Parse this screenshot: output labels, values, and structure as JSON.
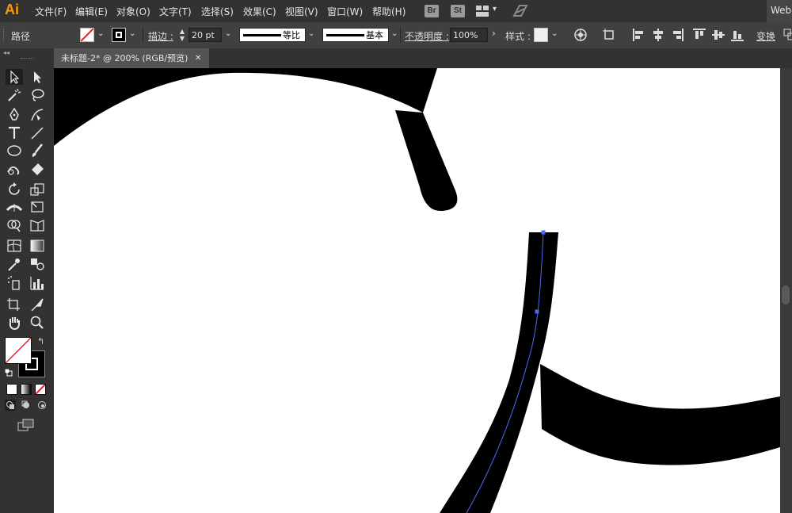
{
  "app": {
    "logo": "Ai",
    "menu": [
      "文件(F)",
      "编辑(E)",
      "对象(O)",
      "文字(T)",
      "选择(S)",
      "效果(C)",
      "视图(V)",
      "窗口(W)",
      "帮助(H)"
    ],
    "bridge_icon": "Br",
    "stock_icon": "St",
    "workspace_label": "Web"
  },
  "control": {
    "selection_label": "路径",
    "stroke_label": "描边 :",
    "stroke_weight": "20 pt",
    "variable_width_profile": "等比",
    "brush_definition": "基本",
    "opacity_label": "不透明度 :",
    "opacity_value": "100%",
    "style_label": "样式 :",
    "transform_label": "变换"
  },
  "document": {
    "tab_title": "未标题-2* @ 200% (RGB/预览)",
    "tab_close": "✕"
  },
  "colors": {
    "accent_logo": "#ff9a00",
    "selection_path": "#4a6cf7",
    "canvas_bg": "#ffffff",
    "shape_fill": "#000000"
  },
  "icons": {
    "bridge": "bridge-icon",
    "stock": "stock-icon",
    "arrange": "arrange-documents-icon",
    "gpu": "gpu-performance-icon",
    "recolor": "recolor-artwork-icon",
    "align": "align-icons"
  }
}
